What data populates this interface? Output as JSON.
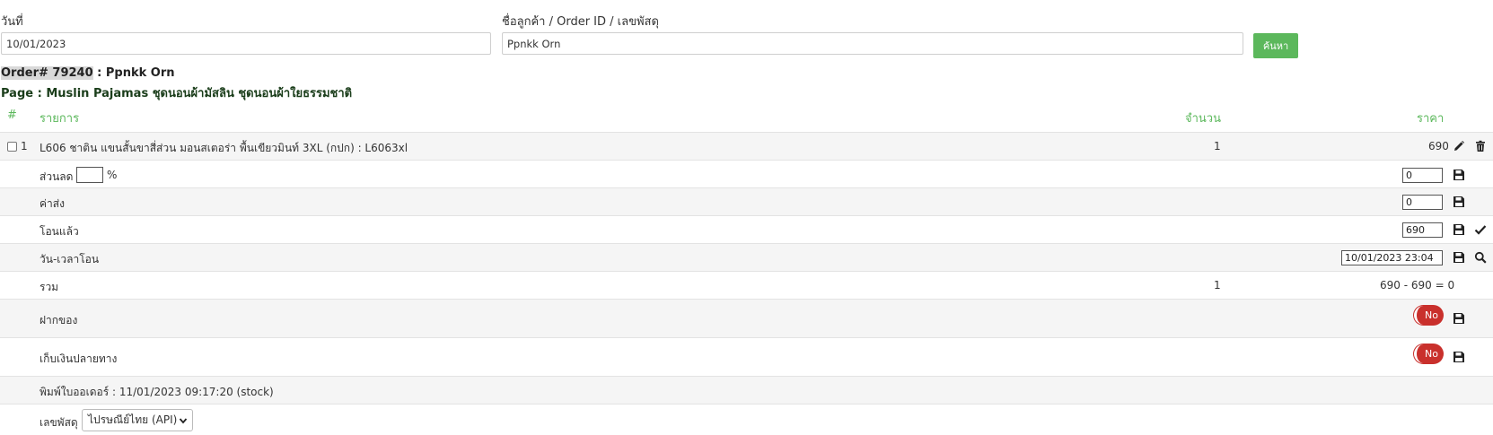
{
  "search": {
    "date_label": "วันที่",
    "date_value": "10/01/2023",
    "customer_label": "ชื่อลูกค้า / Order ID / เลขพัสดุ",
    "customer_value": "Ppnkk Orn",
    "search_button": "ค้นหา"
  },
  "order": {
    "id_label": "Order# 79240",
    "customer_suffix": " : Ppnkk Orn",
    "page_line": "Page : Muslin Pajamas ชุดนอนผ้ามัสลิน ชุดนอนผ้าใยธรรมชาติ"
  },
  "table": {
    "headers": {
      "num": "#",
      "item": "รายการ",
      "qty": "จำนวน",
      "price": "ราคา"
    },
    "item": {
      "index": "1",
      "name": "L606 ชาติน แขนสั้นขาสี่ส่วน มอนสเตอร่า พื้นเขียวมินท์ 3XL (กปก) : L6063xl",
      "qty": "1",
      "price": "690"
    },
    "discount": {
      "label": "ส่วนลด",
      "unit": "%",
      "value": "0"
    },
    "shipping": {
      "label": "ค่าส่ง",
      "value": "0"
    },
    "transferred": {
      "label": "โอนแล้ว",
      "value": "690"
    },
    "transfer_time": {
      "label": "วัน-เวลาโอน",
      "value": "10/01/2023 23:04"
    },
    "total": {
      "label": "รวม",
      "qty": "1",
      "value": "690 - 690 = 0"
    },
    "deposit": {
      "label": "ฝากของ",
      "toggle": "No"
    },
    "cod": {
      "label": "เก็บเงินปลายทาง",
      "toggle": "No"
    },
    "printed": {
      "text": "พิมพ์ใบออเดอร์ : 11/01/2023 09:17:20 (stock)"
    },
    "tracking": {
      "label": "เลขพัสดุ",
      "selected": "ไปรษณีย์ไทย (API)"
    }
  },
  "colors": {
    "accent": "#5cb85c",
    "danger": "#c9302c",
    "row_alt": "#f5f5f5"
  }
}
